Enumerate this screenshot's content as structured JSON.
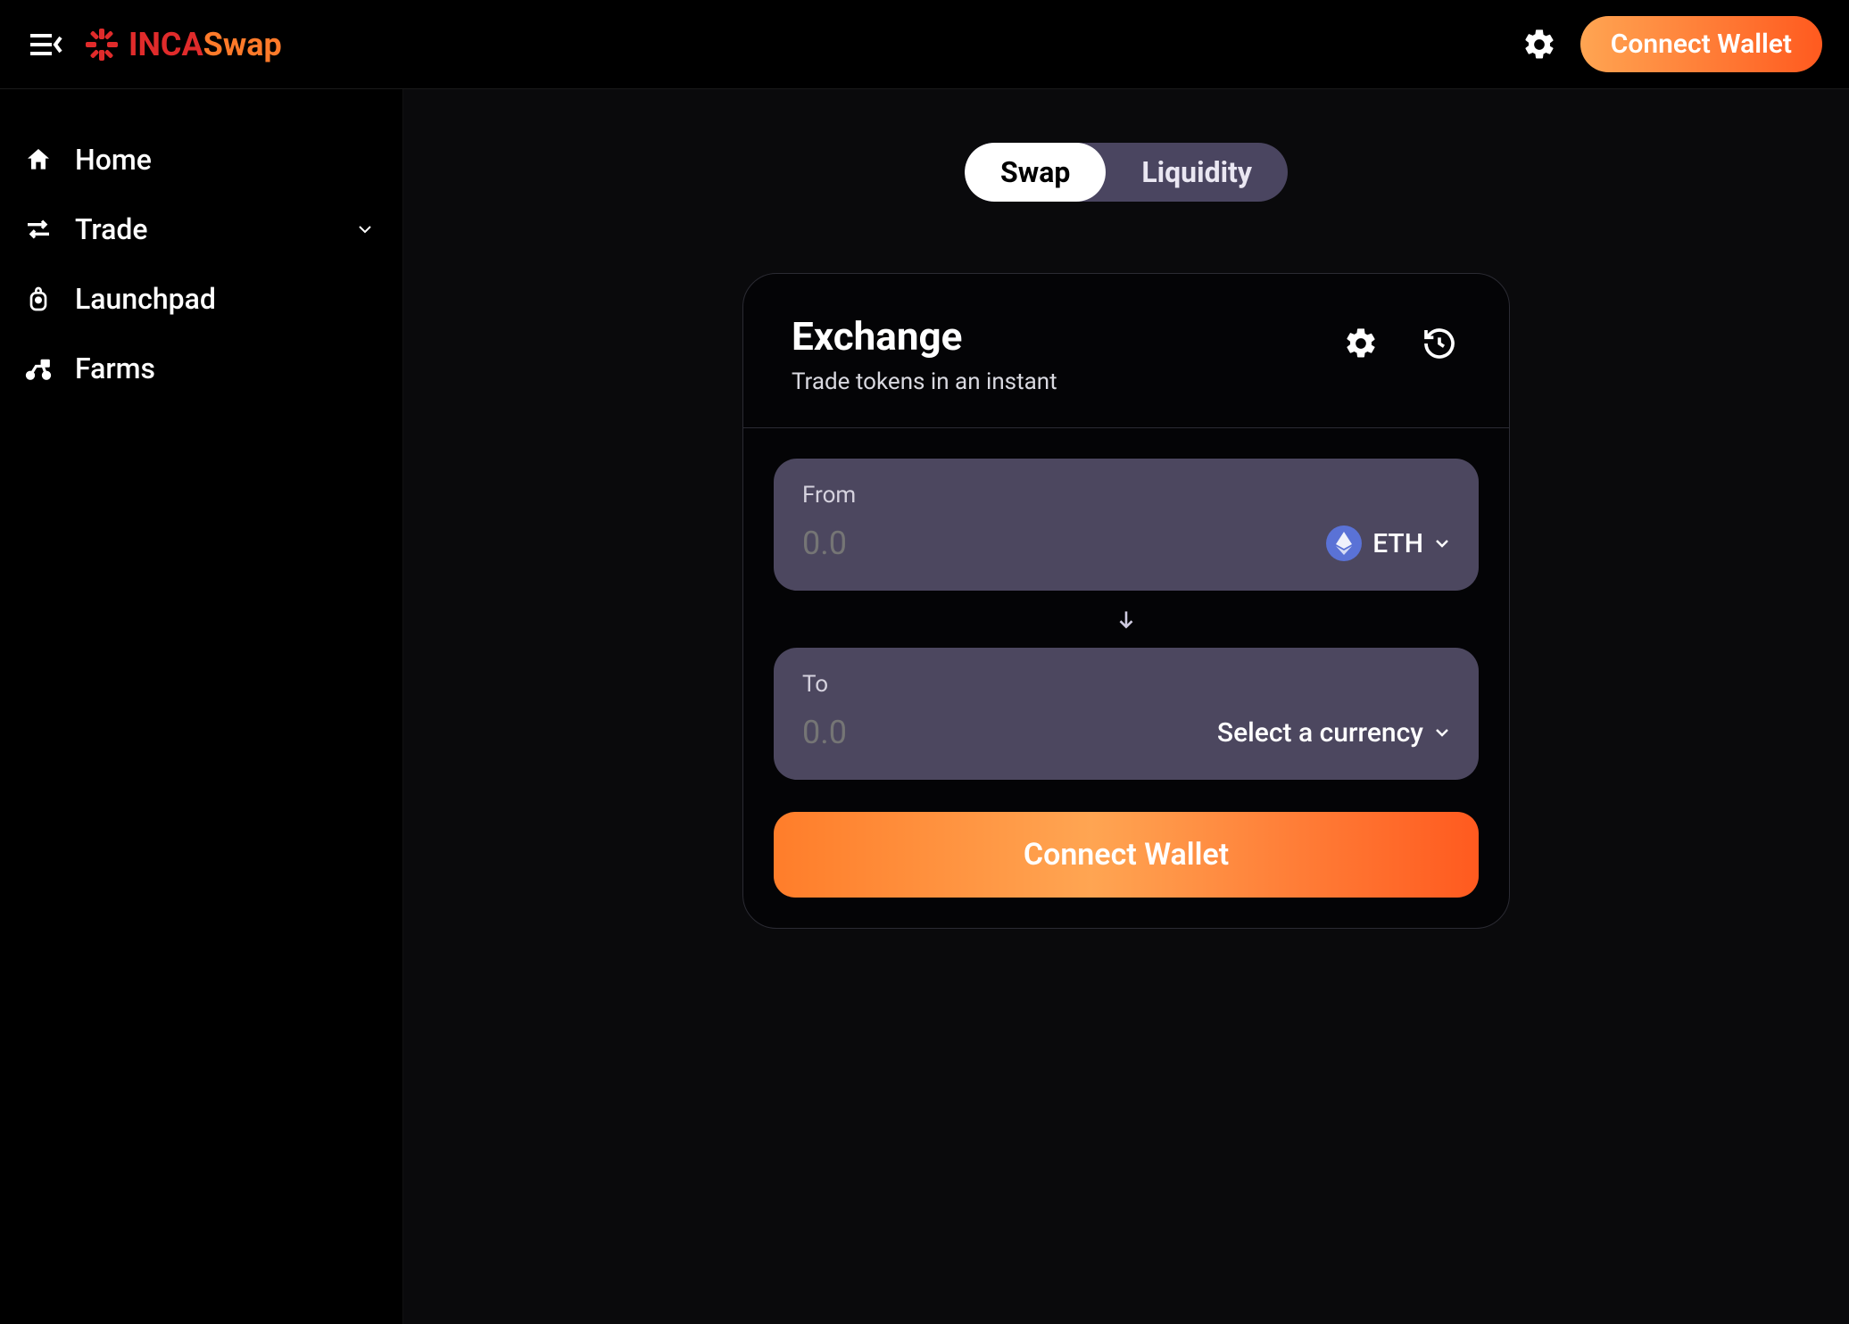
{
  "brand": {
    "part1": "INCA",
    "part2": "Swap"
  },
  "topbar": {
    "connect_label": "Connect Wallet"
  },
  "sidebar": {
    "items": [
      {
        "label": "Home"
      },
      {
        "label": "Trade"
      },
      {
        "label": "Launchpad"
      },
      {
        "label": "Farms"
      }
    ]
  },
  "toggle": {
    "swap": "Swap",
    "liquidity": "Liquidity"
  },
  "card": {
    "title": "Exchange",
    "subtitle": "Trade tokens in an instant",
    "from_label": "From",
    "to_label": "To",
    "from_placeholder": "0.0",
    "to_placeholder": "0.0",
    "from_token": "ETH",
    "to_token": "Select a currency",
    "connect_label": "Connect Wallet"
  }
}
